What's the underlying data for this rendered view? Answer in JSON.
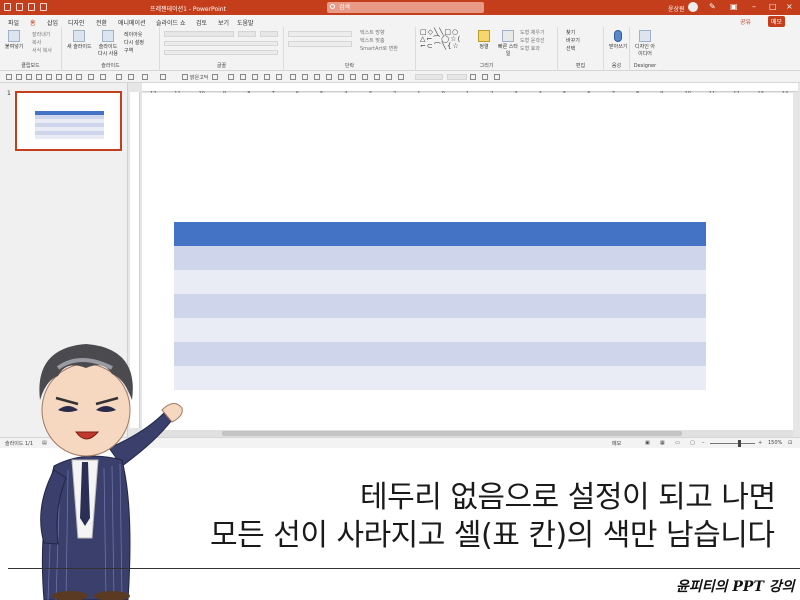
{
  "titlebar": {
    "doc_title": "프레젠테이션1 - PowerPoint",
    "search_placeholder": "검색",
    "user_name": "윤상원"
  },
  "ribbon_tabs": [
    "파일",
    "홈",
    "삽입",
    "디자인",
    "전환",
    "애니메이션",
    "슬라이드 쇼",
    "검토",
    "보기",
    "도움말"
  ],
  "active_tab": "홈",
  "share_label": "공유",
  "comment_label": "메모",
  "ribbon": {
    "clipboard": {
      "label": "클립보드",
      "paste": "붙여넣기",
      "cut": "잘라내기",
      "copy": "복사",
      "format_painter": "서식 복사"
    },
    "slides": {
      "label": "슬라이드",
      "new_slide": "새 슬라이드",
      "reuse": "슬라이드 다시 사용",
      "layout": "레이아웃",
      "reset": "다시 설정",
      "section": "구역"
    },
    "font": {
      "label": "글꼴"
    },
    "paragraph": {
      "label": "단락",
      "text_direction": "텍스트 방향",
      "align_text": "텍스트 맞춤",
      "smartart": "SmartArt로 변환"
    },
    "drawing": {
      "label": "그리기",
      "arrange": "정렬",
      "quick_styles": "빠른 스타일",
      "shape_fill": "도형 채우기",
      "shape_outline": "도형 윤곽선",
      "shape_effects": "도형 효과"
    },
    "editing": {
      "label": "편집",
      "find": "찾기",
      "replace": "바꾸기",
      "select": "선택"
    },
    "voice": {
      "label": "음성",
      "dictate": "받아쓰기"
    },
    "designer": {
      "label": "Designer",
      "design_ideas": "디자인 아이디어"
    }
  },
  "format_bar": {
    "font_style": "맑은고딕"
  },
  "ruler_ticks": [
    "12",
    "11",
    "10",
    "9",
    "8",
    "7",
    "6",
    "5",
    "4",
    "3",
    "2",
    "1",
    "0",
    "1",
    "2",
    "3",
    "4",
    "5",
    "6",
    "7",
    "8",
    "9",
    "10",
    "11",
    "12",
    "13",
    "14"
  ],
  "slide_panel": {
    "number": "1"
  },
  "table": {
    "header_color": "#4472c4",
    "band_dark": "#cfd5ea",
    "band_light": "#e9ebf5",
    "rows": 7
  },
  "statusbar": {
    "slide_count": "슬라이드 1/1",
    "notes": "메모",
    "zoom": "150%"
  },
  "caption": {
    "line1": "테두리 없음으로 설정이 되고 나면",
    "line2": "모든 선이 사라지고 셀(표 칸)의 색만 남습니다"
  },
  "brand": "윤피티의 PPT 강의",
  "accent_color": "#c43e1c"
}
